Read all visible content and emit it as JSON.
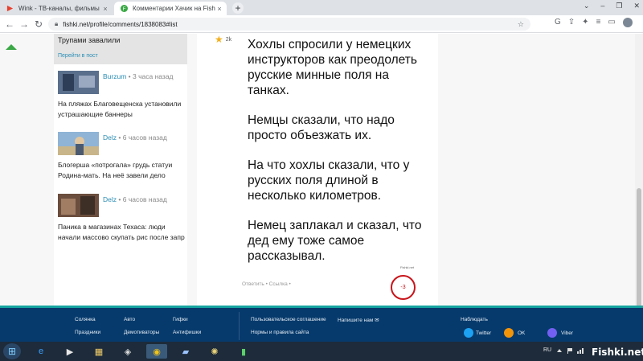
{
  "browser": {
    "tabs": [
      {
        "title": "Wink - ТВ-каналы, фильмы"
      },
      {
        "title": "Комментарии Хачик на Fishki.n"
      }
    ],
    "new_tab_label": "+",
    "close_label": "×",
    "url": "fishki.net/profile/comments/1838083#list"
  },
  "sidebar": {
    "top_title": "Трупами завалили",
    "top_link": "Перейти в пост",
    "items": [
      {
        "author": "Burzum",
        "time": "• 3 часа назад",
        "title": "На пляжах Благовещенска установили устрашающие баннеры"
      },
      {
        "author": "Delz",
        "time": "• 6 часов назад",
        "title": "Блогерша «потрогала» грудь статуи Родина-мать. На неё завели дело"
      },
      {
        "author": "Delz",
        "time": "• 6 часов назад",
        "title": "Паника в магазинах Техаса: люди начали массово скупать рис после запр"
      }
    ]
  },
  "post": {
    "rating": "2k",
    "paragraphs": [
      "Хохлы спросили у немецких инструкторов как преодолеть русские минные поля на танках.",
      "Немцы сказали, что надо просто объезжать их.",
      "На что хохлы сказали, что у русских поля длиной в несколько километров.",
      "Немец заплакал и сказал, что дед ему тоже самое рассказывал."
    ],
    "actions": "Ответить • Ссылка •",
    "watermark_tag": "Fishki.net",
    "vote": "-3"
  },
  "footer": {
    "col1": [
      "Солянка",
      "Праздники"
    ],
    "col2": [
      "Авто",
      "Демотиваторы"
    ],
    "col3": [
      "Гифки",
      "Антифишки"
    ],
    "col4": [
      "Пользовательское соглашение",
      "Нормы и правила сайта"
    ],
    "write_us": "Напишите нам",
    "follow": "Наблюдать",
    "social": [
      "Twitter",
      "OK",
      "Viber"
    ]
  },
  "taskbar": {
    "lang": "RU",
    "watermark": "Fishki.net"
  },
  "colors": {
    "link": "#2b8db5",
    "accent_green": "#3aa845",
    "footer_bg": "#063a6c",
    "vote_red": "#c9151b"
  }
}
